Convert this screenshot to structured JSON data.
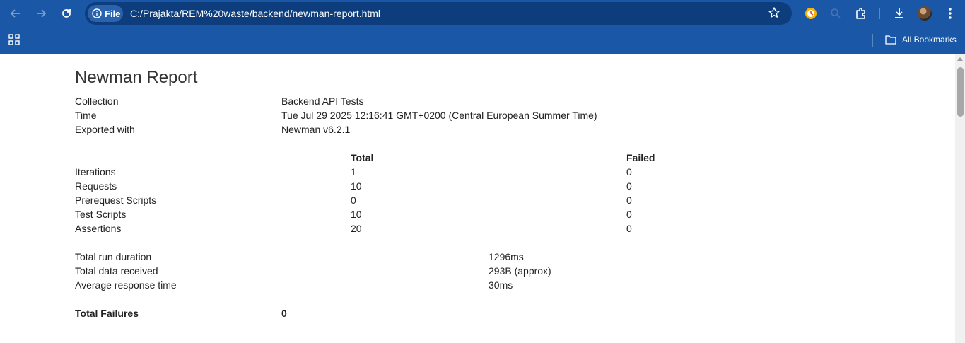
{
  "browser": {
    "site_label": "File",
    "url": "C:/Prajakta/REM%20waste/backend/newman-report.html",
    "bookmarks_label": "All Bookmarks"
  },
  "report": {
    "title": "Newman Report",
    "info": [
      {
        "label": "Collection",
        "value": "Backend API Tests"
      },
      {
        "label": "Time",
        "value": "Tue Jul 29 2025 12:16:41 GMT+0200 (Central European Summer Time)"
      },
      {
        "label": "Exported with",
        "value": "Newman v6.2.1"
      }
    ],
    "summary": {
      "headers": {
        "total": "Total",
        "failed": "Failed"
      },
      "rows": [
        {
          "label": "Iterations",
          "total": "1",
          "failed": "0"
        },
        {
          "label": "Requests",
          "total": "10",
          "failed": "0"
        },
        {
          "label": "Prerequest Scripts",
          "total": "0",
          "failed": "0"
        },
        {
          "label": "Test Scripts",
          "total": "10",
          "failed": "0"
        },
        {
          "label": "Assertions",
          "total": "20",
          "failed": "0"
        }
      ]
    },
    "stats": [
      {
        "label": "Total run duration",
        "value": "1296ms"
      },
      {
        "label": "Total data received",
        "value": "293B (approx)"
      },
      {
        "label": "Average response time",
        "value": "30ms"
      }
    ],
    "failures": {
      "label": "Total Failures",
      "value": "0"
    }
  }
}
